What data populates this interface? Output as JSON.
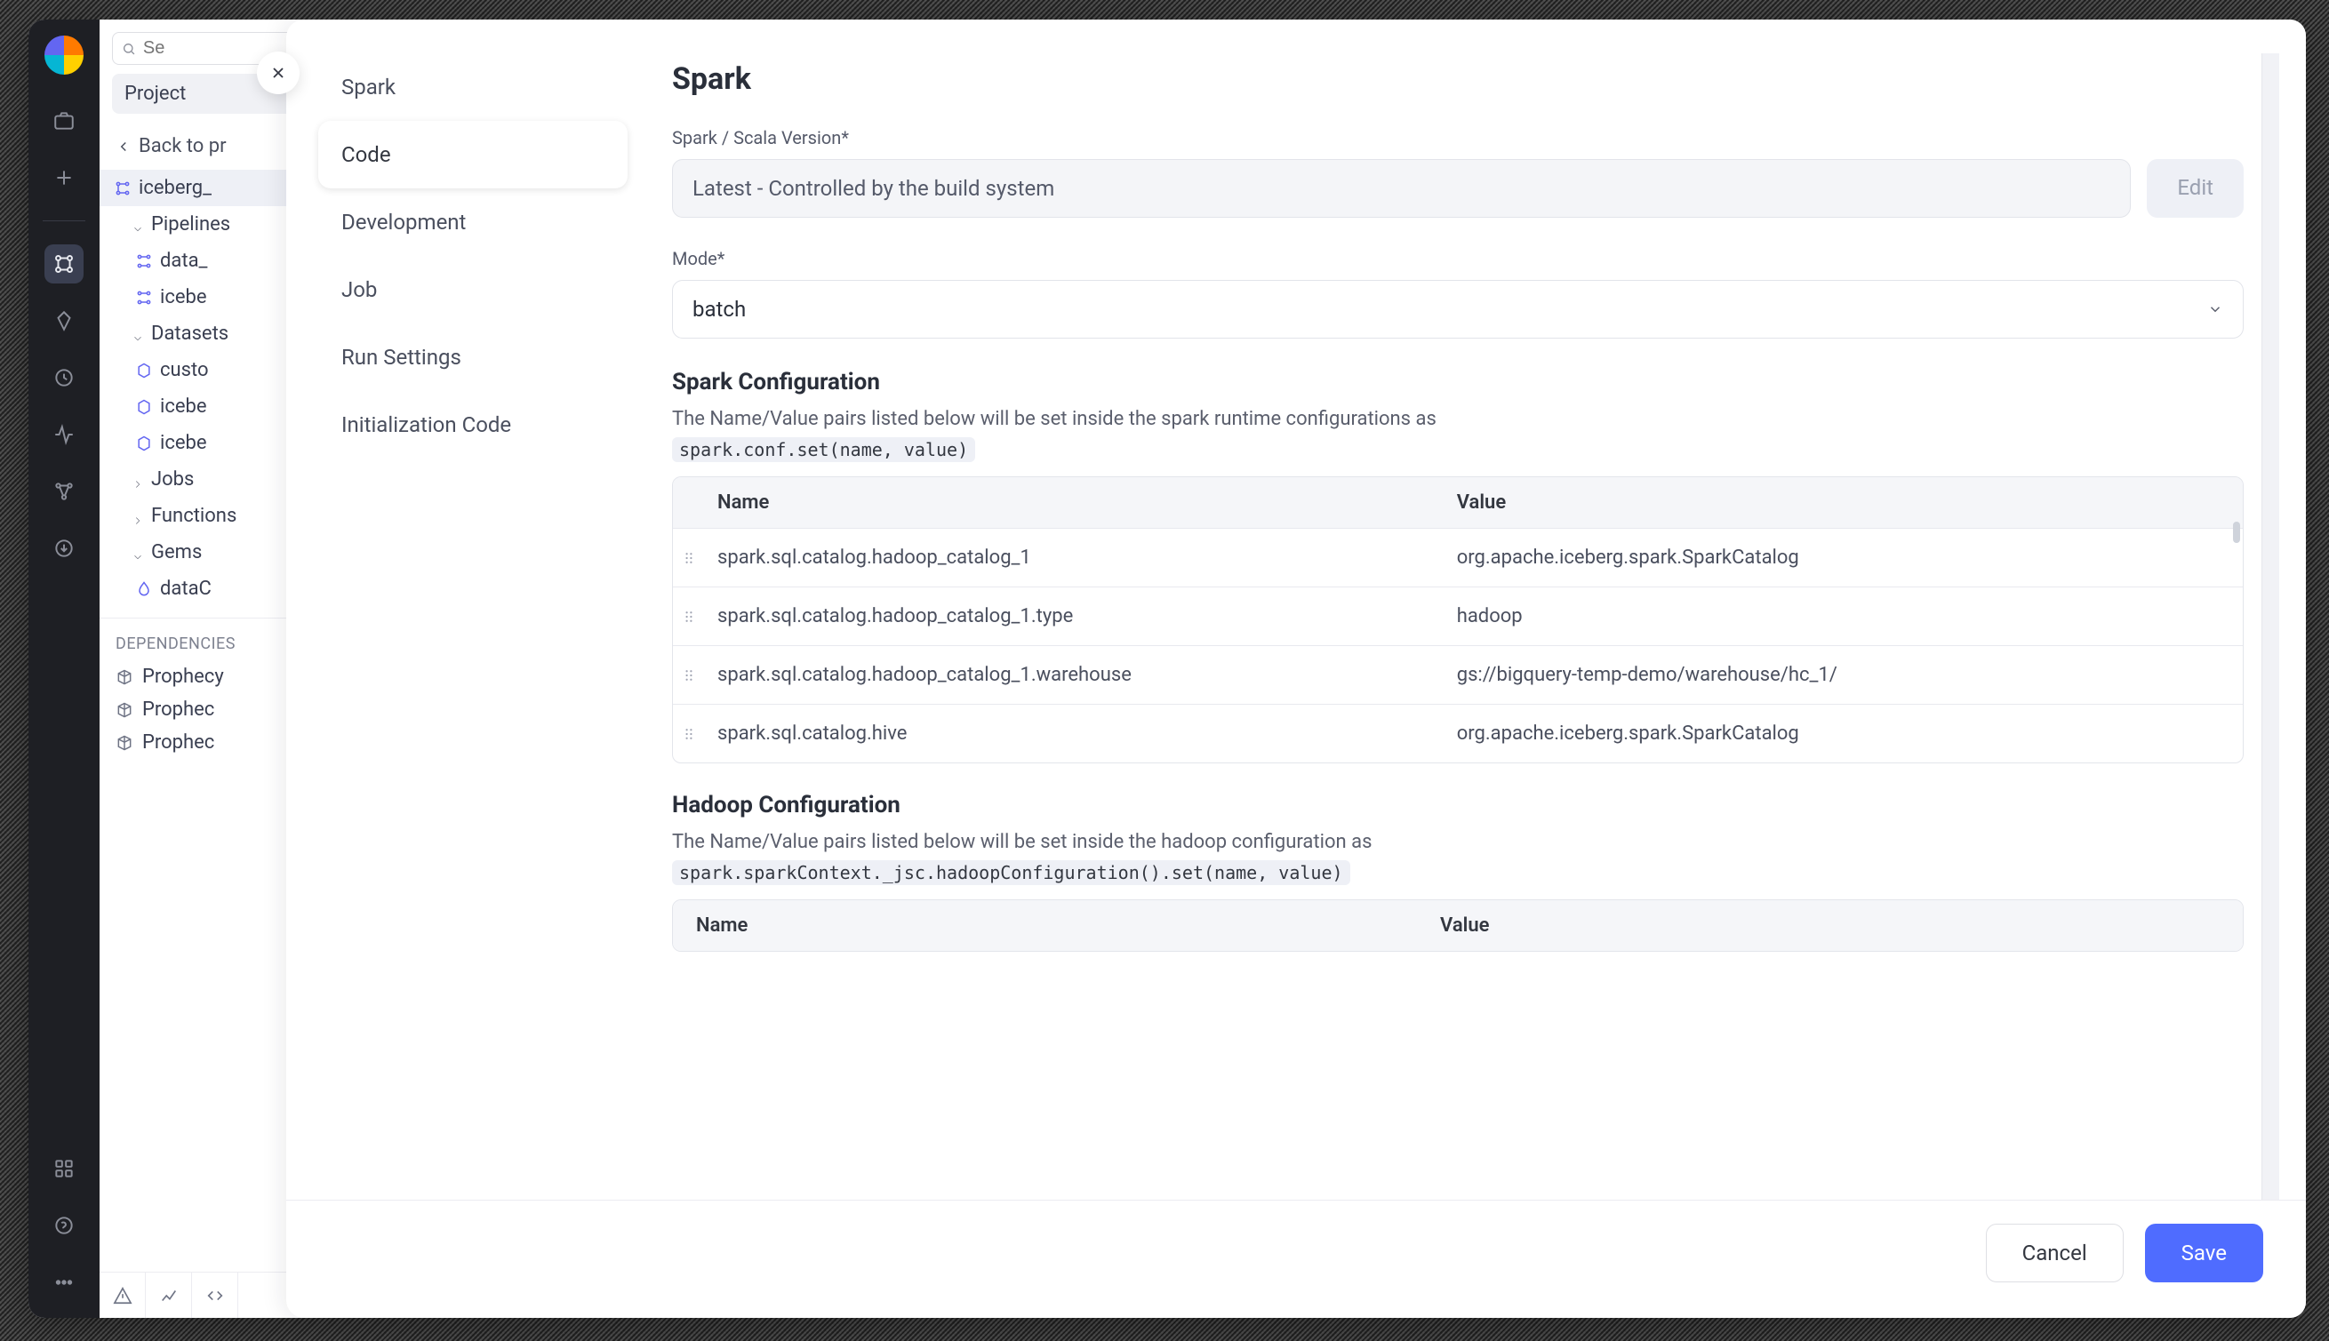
{
  "search_placeholder": "Se",
  "project_label": "Project",
  "back_label": "Back to pr",
  "project_name": "iceberg_",
  "tree": {
    "pipelines": "Pipelines",
    "pipeline_items": [
      "data_",
      "icebe"
    ],
    "datasets": "Datasets",
    "dataset_items": [
      "custo",
      "icebe",
      "icebe"
    ],
    "jobs": "Jobs",
    "functions": "Functions",
    "gems": "Gems",
    "gem_items": [
      "dataC"
    ]
  },
  "dependencies_title": "DEPENDENCIES",
  "dependencies": [
    "Prophecy",
    "Prophec",
    "Prophec"
  ],
  "side_nav": {
    "spark": "Spark",
    "code": "Code",
    "development": "Development",
    "job": "Job",
    "run_settings": "Run Settings",
    "initialization_code": "Initialization Code"
  },
  "page_title": "Spark",
  "version_label": "Spark / Scala Version*",
  "version_value": "Latest - Controlled by the build system",
  "edit_label": "Edit",
  "mode_label": "Mode*",
  "mode_value": "batch",
  "spark_conf_title": "Spark Configuration",
  "spark_conf_desc": "The Name/Value pairs listed below will be set inside the spark runtime configurations as",
  "spark_conf_code": "spark.conf.set(name, value)",
  "table_headers": {
    "name": "Name",
    "value": "Value"
  },
  "spark_rows": [
    {
      "name": "spark.sql.catalog.hadoop_catalog_1",
      "value": "org.apache.iceberg.spark.SparkCatalog"
    },
    {
      "name": "spark.sql.catalog.hadoop_catalog_1.type",
      "value": "hadoop"
    },
    {
      "name": "spark.sql.catalog.hadoop_catalog_1.warehouse",
      "value": "gs://bigquery-temp-demo/warehouse/hc_1/"
    },
    {
      "name": "spark.sql.catalog.hive",
      "value": "org.apache.iceberg.spark.SparkCatalog"
    }
  ],
  "hadoop_conf_title": "Hadoop Configuration",
  "hadoop_conf_desc": "The Name/Value pairs listed below will be set inside the hadoop configuration as",
  "hadoop_conf_code": "spark.sparkContext._jsc.hadoopConfiguration().set(name, value)",
  "cancel_label": "Cancel",
  "save_label": "Save"
}
